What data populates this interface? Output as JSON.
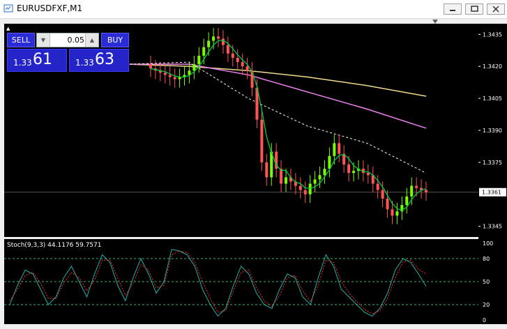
{
  "window": {
    "title": "EURUSDFXF,M1",
    "minimize_label": "–",
    "maximize_label": "▭",
    "close_label": "✕"
  },
  "trade_panel": {
    "sell_label": "SELL",
    "buy_label": "BUY",
    "lot_value": "0.05",
    "sell_quote_small": "1.33",
    "sell_quote_big": "61",
    "buy_quote_small": "1.33",
    "buy_quote_big": "63"
  },
  "price_axis": {
    "ticks": [
      "1.3435",
      "1.3420",
      "1.3405",
      "1.3390",
      "1.3375",
      "1.3345"
    ],
    "current_price": "1.3361"
  },
  "indicator": {
    "label": "Stoch(9,3,3) 44.1176 59.7571",
    "ticks": [
      "100",
      "80",
      "50",
      "20",
      "0"
    ]
  },
  "colors": {
    "bull_candle": "#7cfc00",
    "bear_candle": "#ff5555",
    "ma_fast": "#00cc44",
    "ma_slow": "#ee82ee",
    "ma_long": "#eedd88",
    "ma_dashed": "#ffffff",
    "stoch_main": "#20b2aa",
    "stoch_signal": "#ff3030",
    "panel_blue": "#2424c8"
  },
  "chart_data": [
    {
      "type": "candlestick",
      "title": "EURUSDFXF,M1",
      "ylim": [
        1.334,
        1.344
      ],
      "close": [
        1.3419,
        1.3418,
        1.3417,
        1.3416,
        1.3415,
        1.3414,
        1.3415,
        1.3416,
        1.3418,
        1.3421,
        1.3425,
        1.3429,
        1.3432,
        1.3434,
        1.3433,
        1.343,
        1.3426,
        1.3424,
        1.3422,
        1.342,
        1.3418,
        1.341,
        1.3395,
        1.3375,
        1.3368,
        1.338,
        1.3372,
        1.3365,
        1.3368,
        1.3366,
        1.3364,
        1.3362,
        1.336,
        1.3365,
        1.3367,
        1.3369,
        1.3372,
        1.3378,
        1.3384,
        1.3379,
        1.3374,
        1.337,
        1.3371,
        1.3372,
        1.337,
        1.3369,
        1.3365,
        1.3362,
        1.3358,
        1.3353,
        1.335,
        1.3352,
        1.3355,
        1.3359,
        1.3364,
        1.3363,
        1.3362,
        1.3361
      ],
      "series": [
        {
          "name": "",
          "line": "ma_long",
          "values": [
            1.3421,
            1.342,
            1.3418,
            1.3415,
            1.3411,
            1.3406
          ]
        },
        {
          "name": "",
          "line": "ma_slow",
          "values": [
            1.3421,
            1.3421,
            1.3416,
            1.3408,
            1.34,
            1.3391
          ]
        },
        {
          "name": "",
          "line": "ma_dashed",
          "values": [
            1.3421,
            1.3422,
            1.3405,
            1.3392,
            1.3384,
            1.337
          ]
        }
      ]
    },
    {
      "type": "line",
      "title": "Stoch(9,3,3) 44.1176 59.7571",
      "ylim": [
        0,
        100
      ],
      "series": [
        {
          "name": "",
          "values": [
            20,
            45,
            65,
            60,
            40,
            20,
            30,
            55,
            70,
            50,
            30,
            60,
            85,
            75,
            45,
            25,
            55,
            80,
            60,
            35,
            50,
            92,
            90,
            85,
            70,
            40,
            20,
            5,
            15,
            45,
            70,
            60,
            35,
            20,
            15,
            40,
            60,
            55,
            30,
            20,
            55,
            85,
            70,
            40,
            30,
            20,
            10,
            5,
            15,
            35,
            65,
            80,
            75,
            60,
            44
          ]
        },
        {
          "name": "",
          "values": [
            25,
            40,
            58,
            62,
            48,
            28,
            28,
            48,
            62,
            55,
            38,
            52,
            78,
            78,
            55,
            32,
            48,
            72,
            65,
            42,
            45,
            85,
            90,
            88,
            75,
            50,
            28,
            10,
            12,
            38,
            62,
            65,
            42,
            25,
            18,
            32,
            55,
            58,
            38,
            24,
            45,
            78,
            75,
            50,
            35,
            24,
            14,
            8,
            12,
            28,
            55,
            76,
            78,
            66,
            60
          ]
        }
      ]
    }
  ]
}
